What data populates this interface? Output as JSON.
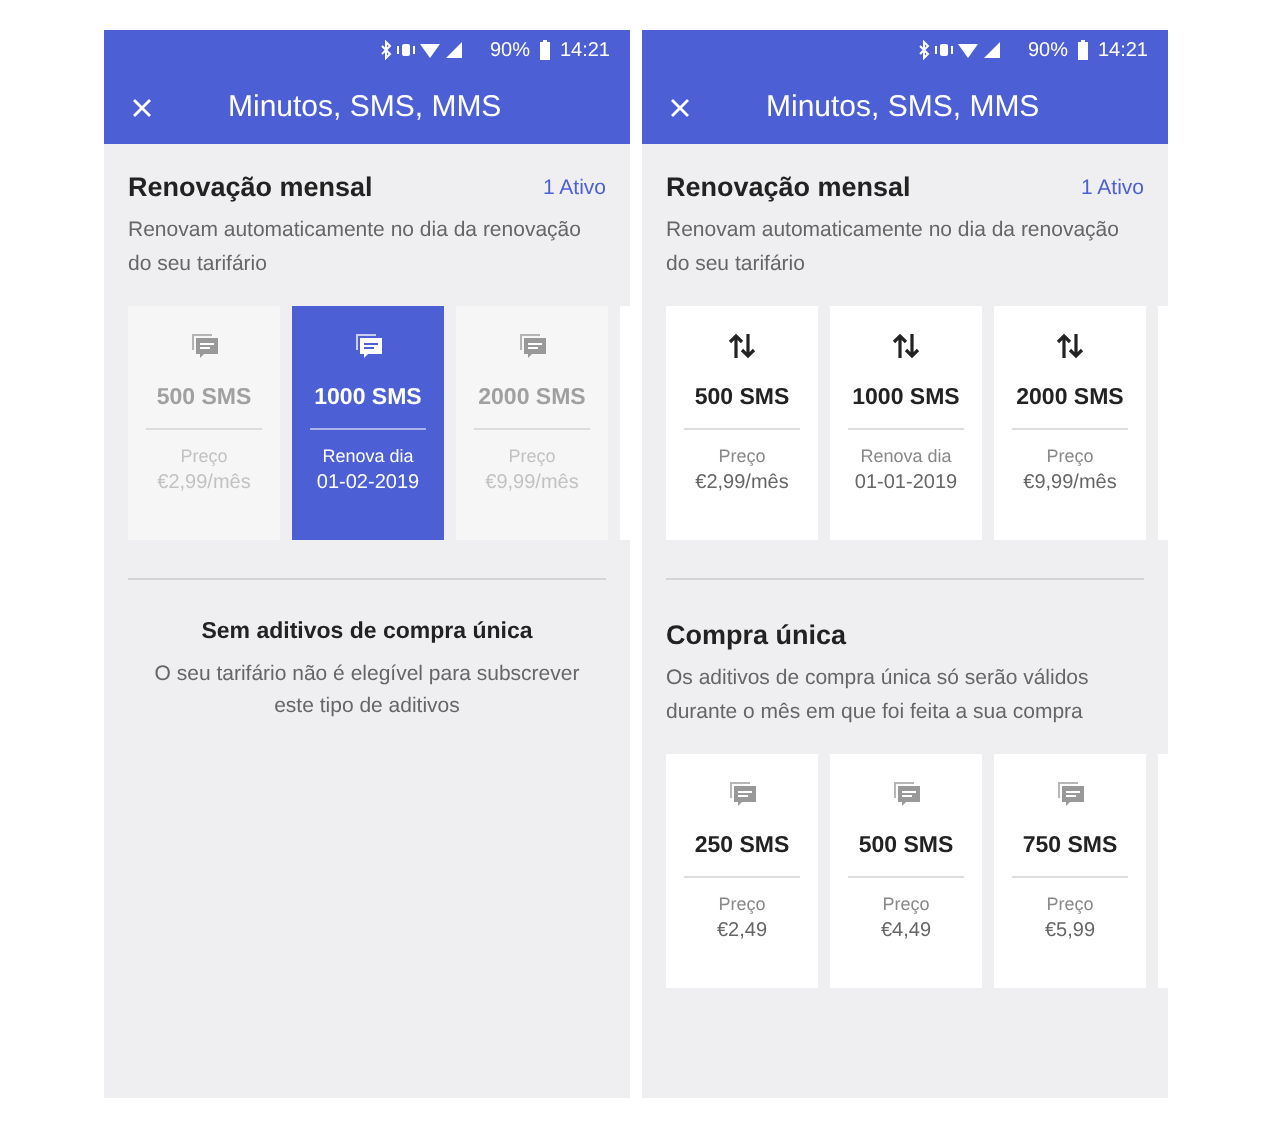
{
  "screens": [
    {
      "status_bar": {
        "battery": "90%",
        "time": "14:21"
      },
      "header": {
        "title": "Minutos, SMS, MMS"
      },
      "sections": [
        {
          "kind": "cards",
          "title": "Renovação mensal",
          "badge": "1 Ativo",
          "description": "Renovam automaticamente no dia da renovação do seu tarifário",
          "cards": [
            {
              "kind": "chat",
              "amount": "500 SMS",
              "label": "Preço",
              "value": "€2,99/mês",
              "selected": false,
              "disabled": true
            },
            {
              "kind": "chat",
              "amount": "1000 SMS",
              "label": "Renova dia",
              "value": "01-02-2019",
              "selected": true,
              "disabled": false
            },
            {
              "kind": "chat",
              "amount": "2000 SMS",
              "label": "Preço",
              "value": "€9,99/mês",
              "selected": false,
              "disabled": true
            }
          ]
        },
        {
          "kind": "empty",
          "title": "Sem aditivos de compra única",
          "description": "O seu tarifário não é elegível para subscrever este tipo de aditivos"
        }
      ]
    },
    {
      "status_bar": {
        "battery": "90%",
        "time": "14:21"
      },
      "header": {
        "title": "Minutos, SMS, MMS"
      },
      "sections": [
        {
          "kind": "cards",
          "title": "Renovação mensal",
          "badge": "1 Ativo",
          "description": "Renovam automaticamente no dia da renovação do seu tarifário",
          "cards": [
            {
              "kind": "arrows",
              "amount": "500 SMS",
              "label": "Preço",
              "value": "€2,99/mês",
              "selected": false,
              "disabled": false
            },
            {
              "kind": "arrows",
              "amount": "1000 SMS",
              "label": "Renova dia",
              "value": "01-01-2019",
              "selected": false,
              "disabled": false
            },
            {
              "kind": "arrows",
              "amount": "2000 SMS",
              "label": "Preço",
              "value": "€9,99/mês",
              "selected": false,
              "disabled": false
            }
          ]
        },
        {
          "kind": "cards",
          "title": "Compra única",
          "description": "Os aditivos de compra única só serão válidos durante o mês em que foi feita a sua compra",
          "cards": [
            {
              "kind": "chat",
              "amount": "250 SMS",
              "label": "Preço",
              "value": "€2,49",
              "selected": false,
              "disabled": false
            },
            {
              "kind": "chat",
              "amount": "500 SMS",
              "label": "Preço",
              "value": "€4,49",
              "selected": false,
              "disabled": false
            },
            {
              "kind": "chat",
              "amount": "750 SMS",
              "label": "Preço",
              "value": "€5,99",
              "selected": false,
              "disabled": false
            }
          ]
        }
      ]
    }
  ]
}
